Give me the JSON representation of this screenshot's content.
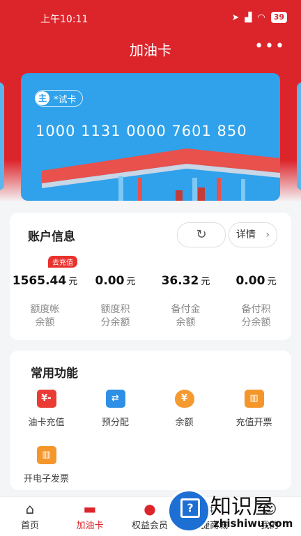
{
  "status_bar": {
    "time": "上午10:11",
    "battery": "39"
  },
  "header": {
    "title": "加油卡",
    "more_icon": "ellipsis-icon"
  },
  "card": {
    "tag_main": "主",
    "tag_label": "*试卡",
    "number": "1000 1131 0000 7601 850"
  },
  "account": {
    "title": "账户信息",
    "detail_label": "详情",
    "recharge_badge": "去充值",
    "items": [
      {
        "value": "1565.44",
        "unit": "元",
        "label1": "额度帐",
        "label2": "余额"
      },
      {
        "value": "0.00",
        "unit": "元",
        "label1": "额度积",
        "label2": "分余额"
      },
      {
        "value": "36.32",
        "unit": "元",
        "label1": "备付金",
        "label2": "余额"
      },
      {
        "value": "0.00",
        "unit": "元",
        "label1": "备付积",
        "label2": "分余额"
      }
    ]
  },
  "functions": {
    "title": "常用功能",
    "items": [
      {
        "label": "油卡充值",
        "icon": "yuan-card-icon",
        "color": "#ea3b34"
      },
      {
        "label": "预分配",
        "icon": "transfer-icon",
        "color": "#2e8fe6"
      },
      {
        "label": "余额",
        "icon": "money-bag-icon",
        "color": "#f59a2f"
      },
      {
        "label": "充值开票",
        "icon": "invoice-icon",
        "color": "#f5962a"
      },
      {
        "label": "开电子发票",
        "icon": "e-invoice-icon",
        "color": "#f5962a"
      }
    ]
  },
  "tabbar": {
    "items": [
      {
        "label": "首页",
        "icon": "home-icon"
      },
      {
        "label": "加油卡",
        "icon": "card-icon"
      },
      {
        "label": "权益会员",
        "icon": "member-icon"
      },
      {
        "label": "便捷商城",
        "icon": "shop-icon"
      },
      {
        "label": "我的",
        "icon": "user-icon"
      }
    ],
    "active_index": 1
  },
  "watermark": {
    "text": "知识屋",
    "url_text": "zhishiwu.com"
  },
  "colors": {
    "brand_red": "#dc252b",
    "card_blue": "#2fa2eb"
  }
}
